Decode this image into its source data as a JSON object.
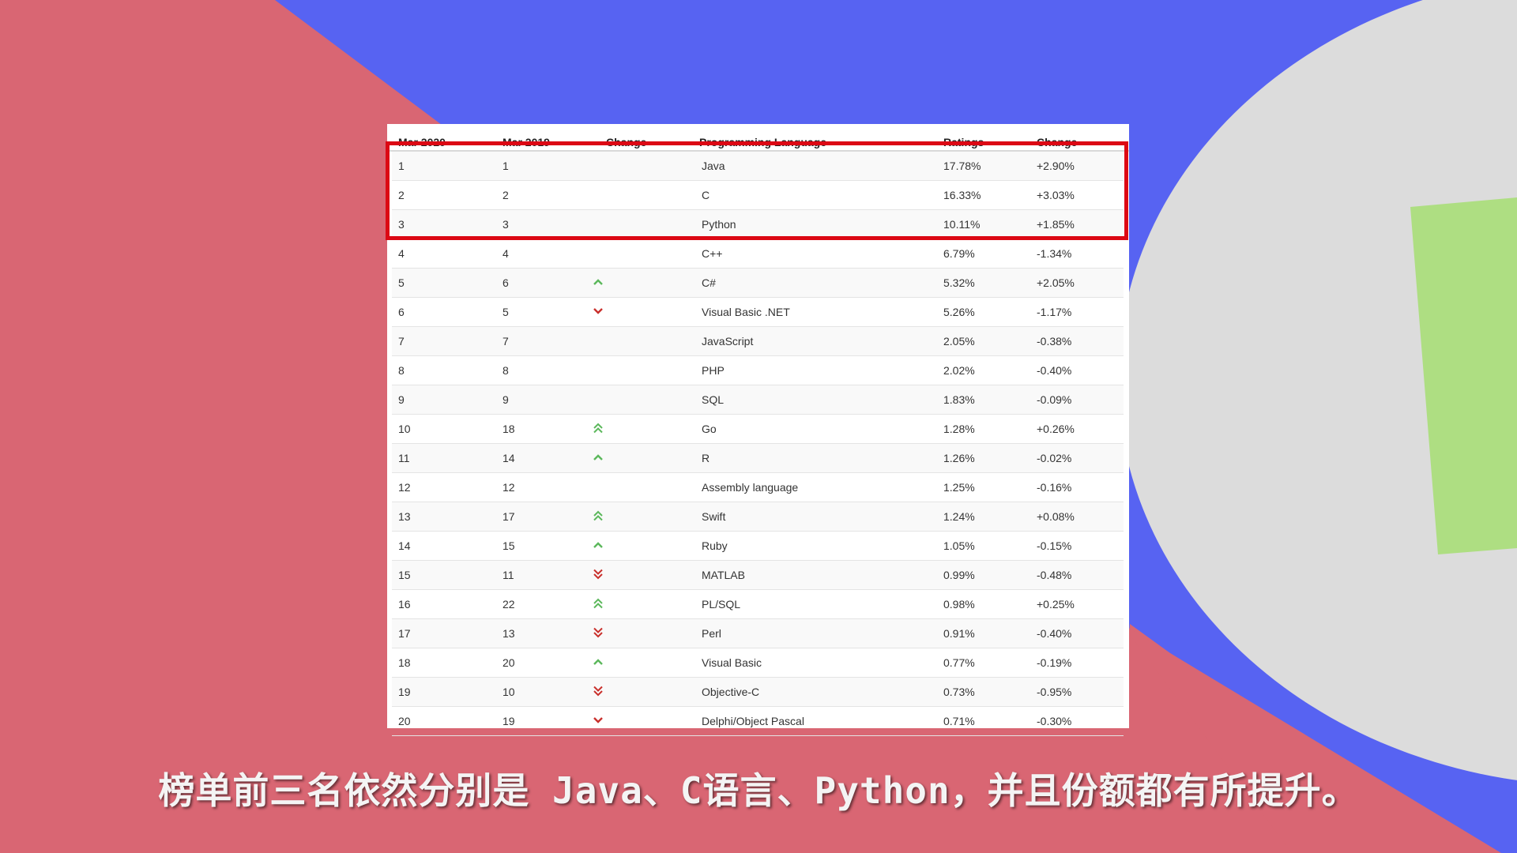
{
  "colors": {
    "background_pink": "#d96673",
    "background_blue": "#5763f2",
    "background_gray": "#dcdcdc",
    "background_green": "#aede82",
    "highlight_red": "#dc0814",
    "up_green": "#5cb85c",
    "down_red": "#c9302c"
  },
  "table": {
    "headers": [
      "Mar 2020",
      "Mar 2019",
      "Change",
      "Programming Language",
      "Ratings",
      "Change"
    ],
    "rows": [
      {
        "rank_2020": "1",
        "rank_2019": "1",
        "change": "none",
        "language": "Java",
        "rating": "17.78%",
        "delta": "+2.90%"
      },
      {
        "rank_2020": "2",
        "rank_2019": "2",
        "change": "none",
        "language": "C",
        "rating": "16.33%",
        "delta": "+3.03%"
      },
      {
        "rank_2020": "3",
        "rank_2019": "3",
        "change": "none",
        "language": "Python",
        "rating": "10.11%",
        "delta": "+1.85%"
      },
      {
        "rank_2020": "4",
        "rank_2019": "4",
        "change": "none",
        "language": "C++",
        "rating": "6.79%",
        "delta": "-1.34%"
      },
      {
        "rank_2020": "5",
        "rank_2019": "6",
        "change": "up",
        "language": "C#",
        "rating": "5.32%",
        "delta": "+2.05%"
      },
      {
        "rank_2020": "6",
        "rank_2019": "5",
        "change": "down",
        "language": "Visual Basic .NET",
        "rating": "5.26%",
        "delta": "-1.17%"
      },
      {
        "rank_2020": "7",
        "rank_2019": "7",
        "change": "none",
        "language": "JavaScript",
        "rating": "2.05%",
        "delta": "-0.38%"
      },
      {
        "rank_2020": "8",
        "rank_2019": "8",
        "change": "none",
        "language": "PHP",
        "rating": "2.02%",
        "delta": "-0.40%"
      },
      {
        "rank_2020": "9",
        "rank_2019": "9",
        "change": "none",
        "language": "SQL",
        "rating": "1.83%",
        "delta": "-0.09%"
      },
      {
        "rank_2020": "10",
        "rank_2019": "18",
        "change": "double-up",
        "language": "Go",
        "rating": "1.28%",
        "delta": "+0.26%"
      },
      {
        "rank_2020": "11",
        "rank_2019": "14",
        "change": "up",
        "language": "R",
        "rating": "1.26%",
        "delta": "-0.02%"
      },
      {
        "rank_2020": "12",
        "rank_2019": "12",
        "change": "none",
        "language": "Assembly language",
        "rating": "1.25%",
        "delta": "-0.16%"
      },
      {
        "rank_2020": "13",
        "rank_2019": "17",
        "change": "double-up",
        "language": "Swift",
        "rating": "1.24%",
        "delta": "+0.08%"
      },
      {
        "rank_2020": "14",
        "rank_2019": "15",
        "change": "up",
        "language": "Ruby",
        "rating": "1.05%",
        "delta": "-0.15%"
      },
      {
        "rank_2020": "15",
        "rank_2019": "11",
        "change": "double-down",
        "language": "MATLAB",
        "rating": "0.99%",
        "delta": "-0.48%"
      },
      {
        "rank_2020": "16",
        "rank_2019": "22",
        "change": "double-up",
        "language": "PL/SQL",
        "rating": "0.98%",
        "delta": "+0.25%"
      },
      {
        "rank_2020": "17",
        "rank_2019": "13",
        "change": "double-down",
        "language": "Perl",
        "rating": "0.91%",
        "delta": "-0.40%"
      },
      {
        "rank_2020": "18",
        "rank_2019": "20",
        "change": "up",
        "language": "Visual Basic",
        "rating": "0.77%",
        "delta": "-0.19%"
      },
      {
        "rank_2020": "19",
        "rank_2019": "10",
        "change": "double-down",
        "language": "Objective-C",
        "rating": "0.73%",
        "delta": "-0.95%"
      },
      {
        "rank_2020": "20",
        "rank_2019": "19",
        "change": "down",
        "language": "Delphi/Object Pascal",
        "rating": "0.71%",
        "delta": "-0.30%"
      }
    ]
  },
  "subtitle": "榜单前三名依然分别是 Java、C语言、Python，并且份额都有所提升。"
}
